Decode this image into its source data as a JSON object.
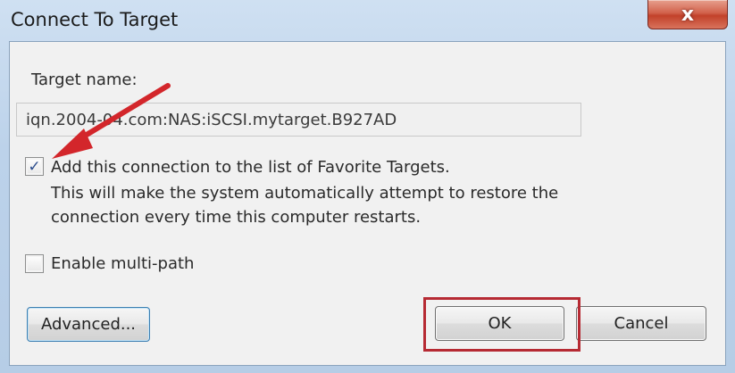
{
  "window": {
    "title": "Connect To Target",
    "close_glyph": "x"
  },
  "form": {
    "target_label": "Target name:",
    "target_value": "iqn.2004-04.com:NAS:iSCSI.mytarget.B927AD",
    "favorite": {
      "label": "Add this connection to the list of Favorite Targets.",
      "description_line1": "This will make the system automatically attempt to restore the",
      "description_line2": "connection every time this computer restarts.",
      "checked": true,
      "check_glyph": "✓"
    },
    "multipath": {
      "label": "Enable multi-path",
      "checked": false
    }
  },
  "buttons": {
    "advanced": "Advanced...",
    "ok": "OK",
    "cancel": "Cancel"
  },
  "annotations": {
    "arrow_color": "#d3262b",
    "highlight_color": "#b62a33"
  },
  "colors": {
    "titlebar": "#bcd2ea",
    "client_bg": "#f1f1f1",
    "close_button": "#c2412a"
  }
}
